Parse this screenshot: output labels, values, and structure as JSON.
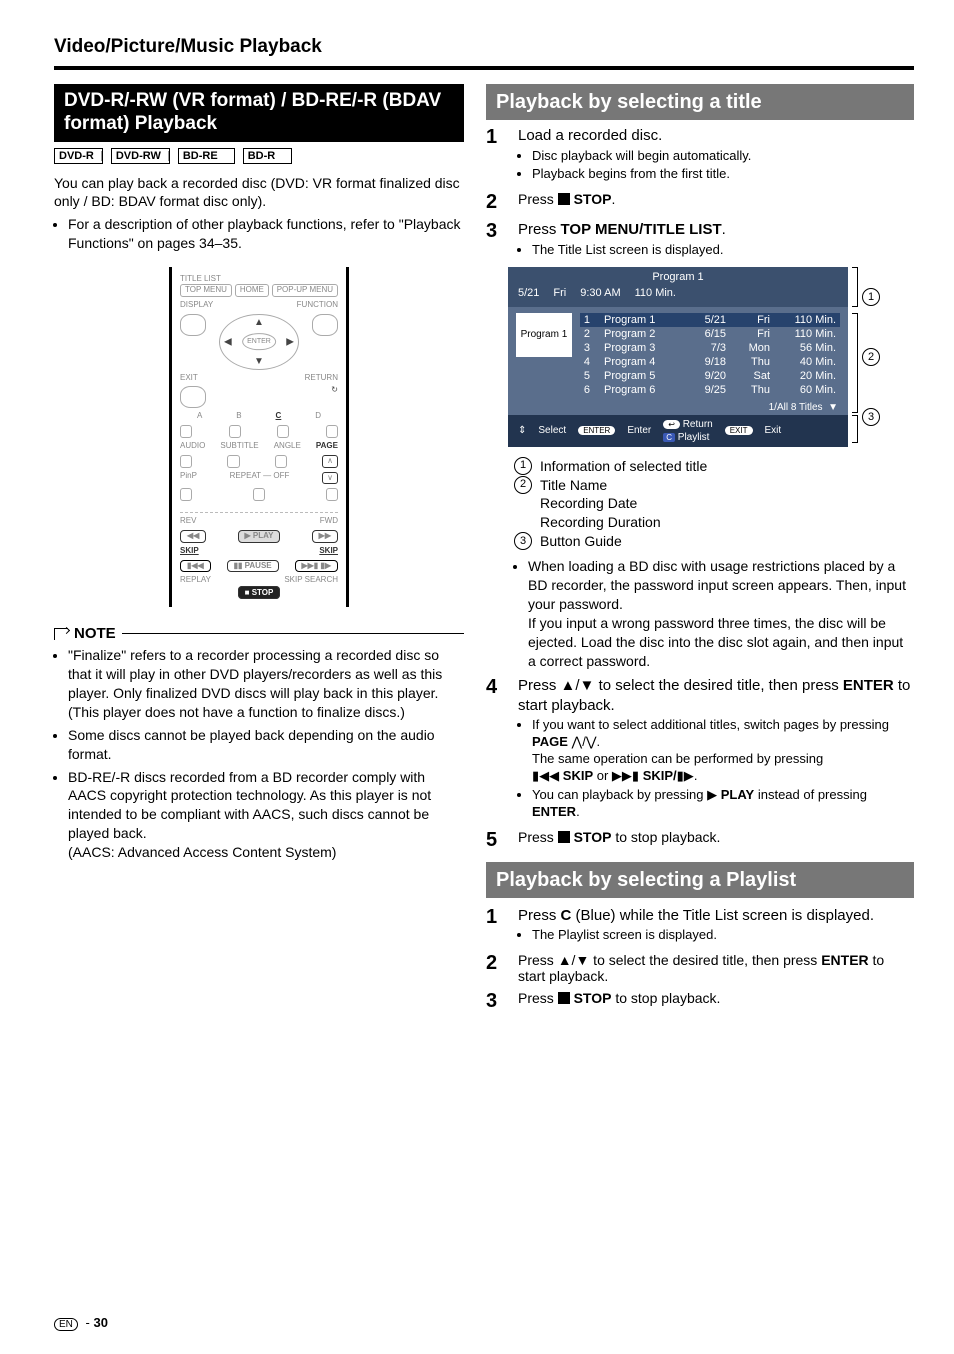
{
  "header": "Video/Picture/Music Playback",
  "left": {
    "sectionTitle": "DVD-R/-RW (VR format) / BD-RE/-R (BDAV format) Playback",
    "badges": [
      "DVD-R",
      "DVD-RW",
      "BD-RE",
      "BD-R"
    ],
    "intro": "You can play back a recorded disc (DVD: VR format finalized disc only / BD: BDAV format disc only).",
    "introBullet": "For a description of other playback functions, refer to \"Playback Functions\" on pages 34–35.",
    "remote": {
      "titleList": "TITLE LIST",
      "topMenu": "TOP MENU",
      "home": "HOME",
      "popup": "POP-UP MENU",
      "display": "DISPLAY",
      "function": "FUNCTION",
      "enter": "ENTER",
      "exit": "EXIT",
      "return": "RETURN",
      "a": "A",
      "b": "B",
      "c": "C",
      "d": "D",
      "audio": "AUDIO",
      "subtitle": "SUBTITLE",
      "angle": "ANGLE",
      "page": "PAGE",
      "pinp": "PinP",
      "repeat": "REPEAT",
      "off": "OFF",
      "rev": "REV",
      "fwd": "FWD",
      "play": "PLAY",
      "pause": "PAUSE",
      "skip": "SKIP",
      "replay": "REPLAY",
      "skipsearch": "SKIP SEARCH",
      "stop": "STOP"
    },
    "noteTitle": "NOTE",
    "notes": [
      "\"Finalize\" refers to a recorder processing a recorded disc so that it will play in other DVD players/recorders as well as this player. Only finalized DVD discs will play back in this player. (This player does not have a function to finalize discs.)",
      "Some discs cannot be played back depending on the audio format.",
      "BD-RE/-R discs recorded from a BD recorder comply with AACS copyright protection technology. As this player is not intended to be compliant with AACS, such discs cannot be played back."
    ],
    "aacsLine": "(AACS: Advanced Access Content System)"
  },
  "right": {
    "titleSection": "Playback by selecting a title",
    "s1": {
      "line": "Load a recorded disc.",
      "subs": [
        "Disc playback will begin automatically.",
        "Playback begins from the first title."
      ]
    },
    "s2_label": "Press ",
    "s2_stop": " STOP",
    "s2_end": ".",
    "s3_label": "Press ",
    "s3_btn": "TOP MENU/TITLE LIST",
    "s3_end": ".",
    "s3_sub": "The Title List screen is displayed.",
    "tl": {
      "headTitle": "Program 1",
      "infoDate": "5/21",
      "infoDay": "Fri",
      "infoTime": "9:30 AM",
      "infoDur": "110 Min.",
      "thumb": "Program 1",
      "rows": [
        {
          "idx": "1",
          "name": "Program 1",
          "date": "5/21",
          "day": "Fri",
          "dur": "110 Min."
        },
        {
          "idx": "2",
          "name": "Program 2",
          "date": "6/15",
          "day": "Fri",
          "dur": "110 Min."
        },
        {
          "idx": "3",
          "name": "Program 3",
          "date": "7/3",
          "day": "Mon",
          "dur": "56 Min."
        },
        {
          "idx": "4",
          "name": "Program 4",
          "date": "9/18",
          "day": "Thu",
          "dur": "40 Min."
        },
        {
          "idx": "5",
          "name": "Program 5",
          "date": "9/20",
          "day": "Sat",
          "dur": "20 Min."
        },
        {
          "idx": "6",
          "name": "Program 6",
          "date": "9/25",
          "day": "Thu",
          "dur": "60 Min."
        }
      ],
      "counter": "1/All 8 Titles",
      "foot": {
        "select": "Select",
        "enterIco": "ENTER",
        "enter": "Enter",
        "returnIco": "↩",
        "return": "Return",
        "playlistIco": "C",
        "playlist": "Playlist",
        "exitIco": "EXIT",
        "exit": "Exit"
      }
    },
    "legend": {
      "l1": "Information of selected title",
      "l2a": "Title Name",
      "l2b": "Recording Date",
      "l2c": "Recording Duration",
      "l3": "Button Guide"
    },
    "bdNote": "When loading a BD disc with usage restrictions placed by a BD recorder, the password input screen appears. Then, input your password.",
    "bdNote2": "If you input a wrong password three times, the disc will be ejected. Load the disc into the disc slot again, and then input a correct password.",
    "s4": {
      "line_a": "Press ",
      "line_b": " to select the desired title, then press ",
      "enter": "ENTER",
      "line_c": " to start playback.",
      "subs_a": "If you want to select additional titles, switch pages by pressing ",
      "page": "PAGE",
      "subs_a2": ".",
      "same": "The same operation can be performed by pressing ",
      "skip1": " SKIP",
      "or": " or ",
      "skip2": " SKIP/",
      "same_end": ".",
      "play_a": "You can playback by pressing ",
      "play_lbl": " PLAY",
      "play_b": " instead of pressing ",
      "play_enter": "ENTER",
      "play_c": "."
    },
    "s5_a": "Press ",
    "s5_stop": " STOP",
    "s5_b": " to stop playback.",
    "playlistSection": "Playback by selecting a Playlist",
    "p1_a": "Press ",
    "p1_c": "C",
    "p1_b": " (Blue) while the Title List screen is displayed.",
    "p1_sub": "The Playlist screen is displayed.",
    "p2_a": "Press ",
    "p2_b": " to select the desired title, then press ",
    "p2_enter": "ENTER",
    "p2_c": " to start playback.",
    "p3_a": "Press ",
    "p3_stop": " STOP",
    "p3_b": " to stop playback."
  },
  "footer": {
    "en": "EN",
    "dash": " - ",
    "page": "30"
  }
}
